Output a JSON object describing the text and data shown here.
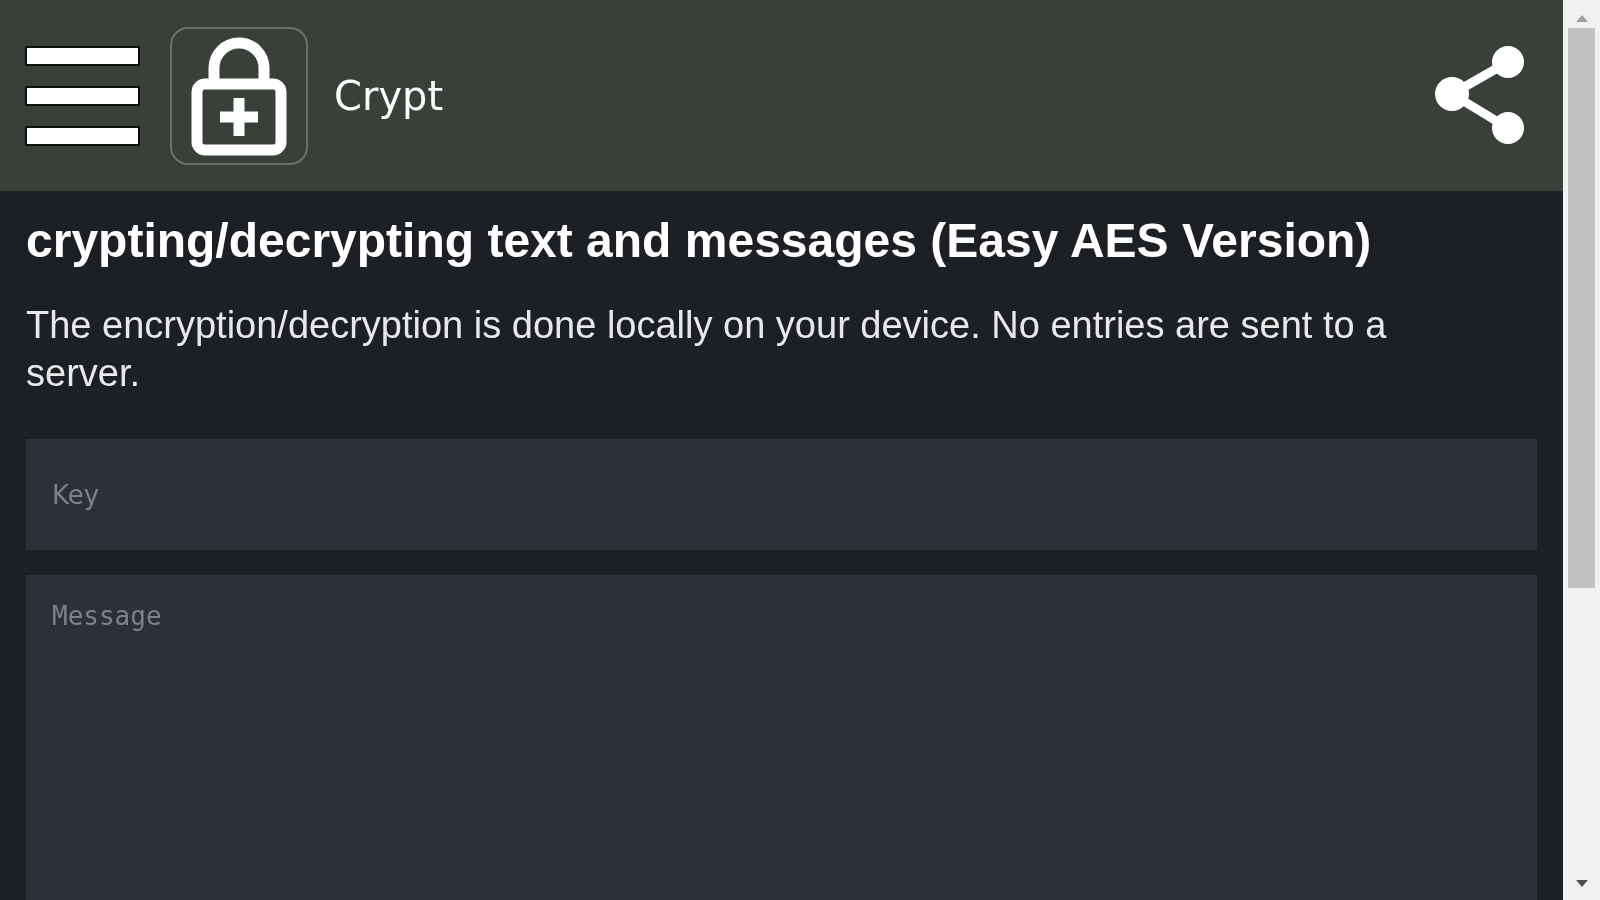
{
  "header": {
    "title": "Crypt"
  },
  "heading": "crypting/decrypting text and messages (Easy AES Version)",
  "intro": "The encryption/decryption is done locally on your device. No entries are sent to a server.",
  "key_field": {
    "placeholder": "Key"
  },
  "message_field": {
    "placeholder": "Message"
  }
}
